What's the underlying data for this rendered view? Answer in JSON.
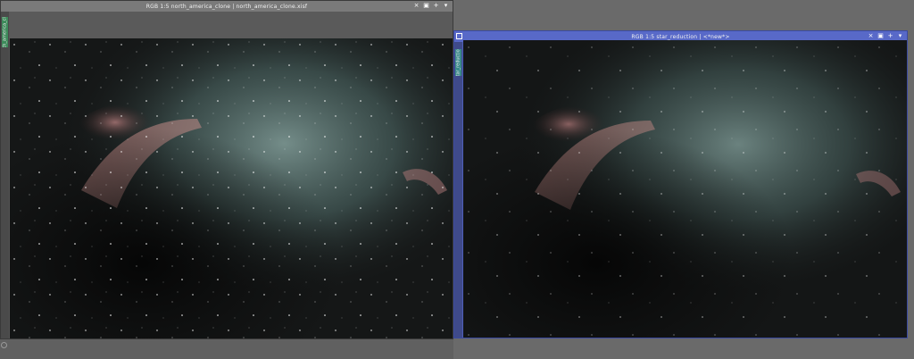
{
  "windows": [
    {
      "title": "RGB 1:5 north_america_clone | north_america_clone.xisf",
      "side_tab": "north_america_clone",
      "controls": [
        "×",
        "▣",
        "+",
        "▾"
      ]
    },
    {
      "title": "RGB 1:5 star_reduction | <*new*>",
      "side_tab": "star_reduction",
      "controls": [
        "×",
        "▣",
        "+",
        "▾"
      ]
    }
  ],
  "colors": {
    "workspace": "#5b5b5b",
    "active_frame": "#4f5fb8",
    "inactive_title": "#7a7a7a",
    "tab_green": "#3d8b5a"
  },
  "icons": {
    "close": "close-icon",
    "maximize": "maximize-icon",
    "shade": "shade-icon",
    "menu": "menu-icon"
  }
}
